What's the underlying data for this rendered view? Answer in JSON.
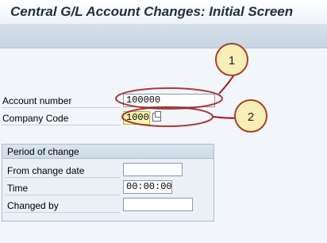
{
  "window": {
    "title": "Central G/L Account Changes: Initial Screen"
  },
  "form": {
    "account_number": {
      "label": "Account number",
      "value": "100000"
    },
    "company_code": {
      "label": "Company Code",
      "value": "1000"
    }
  },
  "period_group": {
    "title": "Period of change",
    "from_change_date": {
      "label": "From change date",
      "value": ""
    },
    "time": {
      "label": "Time",
      "value": "00:00:00"
    },
    "changed_by": {
      "label": "Changed by",
      "value": ""
    }
  },
  "callouts": [
    "1",
    "2"
  ],
  "colors": {
    "annotation_red": "#9b1b1b",
    "balloon_fill": "#f8efb8",
    "required_field": "#fff7b3"
  }
}
